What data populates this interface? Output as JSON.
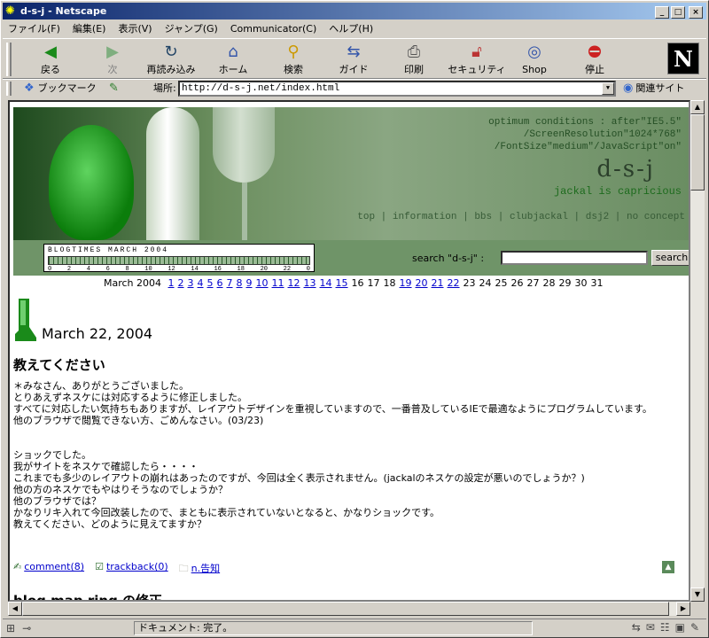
{
  "window": {
    "title": "d-s-j - Netscape",
    "min": "_",
    "max": "□",
    "close": "×"
  },
  "menu": [
    "ファイル(F)",
    "編集(E)",
    "表示(V)",
    "ジャンプ(G)",
    "Communicator(C)",
    "ヘルプ(H)"
  ],
  "toolbar": {
    "buttons": [
      {
        "label": "戻る",
        "icon": "back-icon"
      },
      {
        "label": "次",
        "icon": "forward-icon"
      },
      {
        "label": "再読み込み",
        "icon": "reload-icon"
      },
      {
        "label": "ホーム",
        "icon": "home-icon"
      },
      {
        "label": "検索",
        "icon": "search-icon"
      },
      {
        "label": "ガイド",
        "icon": "guide-icon"
      },
      {
        "label": "印刷",
        "icon": "print-icon"
      },
      {
        "label": "セキュリティ",
        "icon": "security-icon"
      },
      {
        "label": "Shop",
        "icon": "shop-icon"
      },
      {
        "label": "停止",
        "icon": "stop-icon"
      }
    ],
    "logo": "N"
  },
  "location": {
    "bookmark": "ブックマーク",
    "label": "場所:",
    "url": "http://d-s-j.net/index.html",
    "related": "関連サイト"
  },
  "banner": {
    "opt1": "optimum conditions : after\"IE5.5\"",
    "opt2": "/ScreenResolution\"1024*768\"",
    "opt3": "/FontSize\"medium\"/JavaScript\"on\"",
    "logo": "d-s-j",
    "subtitle": "jackal is capricious",
    "nav": [
      "top",
      "information",
      "bbs",
      "clubjackal",
      "dsj2",
      "no concept"
    ]
  },
  "blogtimes": {
    "title": "BLOGTIMES  MARCH 2004",
    "axis": [
      "0",
      "2",
      "4",
      "6",
      "8",
      "10",
      "12",
      "14",
      "16",
      "18",
      "20",
      "22",
      "0"
    ]
  },
  "search": {
    "label": "search \"d-s-j\" :",
    "button": "search",
    "value": ""
  },
  "calendar": {
    "month": "March 2004",
    "days": [
      {
        "d": "1",
        "link": true
      },
      {
        "d": "2",
        "link": true
      },
      {
        "d": "3",
        "link": true
      },
      {
        "d": "4",
        "link": true
      },
      {
        "d": "5",
        "link": true
      },
      {
        "d": "6",
        "link": true
      },
      {
        "d": "7",
        "link": true
      },
      {
        "d": "8",
        "link": true
      },
      {
        "d": "9",
        "link": true
      },
      {
        "d": "10",
        "link": true
      },
      {
        "d": "11",
        "link": true
      },
      {
        "d": "12",
        "link": true
      },
      {
        "d": "13",
        "link": true
      },
      {
        "d": "14",
        "link": true
      },
      {
        "d": "15",
        "link": true
      },
      {
        "d": "16",
        "link": false
      },
      {
        "d": "17",
        "link": false
      },
      {
        "d": "18",
        "link": false
      },
      {
        "d": "19",
        "link": true
      },
      {
        "d": "20",
        "link": true
      },
      {
        "d": "21",
        "link": true
      },
      {
        "d": "22",
        "link": true
      },
      {
        "d": "23",
        "link": false
      },
      {
        "d": "24",
        "link": false
      },
      {
        "d": "25",
        "link": false
      },
      {
        "d": "26",
        "link": false
      },
      {
        "d": "27",
        "link": false
      },
      {
        "d": "28",
        "link": false
      },
      {
        "d": "29",
        "link": false
      },
      {
        "d": "30",
        "link": false
      },
      {
        "d": "31",
        "link": false
      }
    ]
  },
  "post": {
    "date": "March 22, 2004",
    "title": "教えてください",
    "para1": "＊みなさん、ありがとうございました。\nとりあえずネスケには対応するように修正しました。\nすべてに対応したい気持ちもありますが、レイアウトデザインを重視していますので、一番普及しているIEで最適なようにプログラムしています。\n他のブラウザで閲覧できない方、ごめんなさい。(03/23)",
    "para2": "ショックでした。\n我がサイトをネスケで確認したら・・・・\nこれまでも多少のレイアウトの崩れはあったのですが、今回は全く表示されません。(jackalのネスケの設定が悪いのでしょうか？)\n他の方のネスケでもやはりそうなのでしょうか？\n他のブラウザでは？\nかなりリキ入れて今回改装したので、まともに表示されていないとなると、かなりショックです。\n教えてください、どのように見えてますか？",
    "comment": "comment(8)",
    "trackback": "trackback(0)",
    "category": "n.告知"
  },
  "next_post_title": "blog map ring の修正",
  "status": {
    "text": "ドキュメント: 完了。"
  },
  "colors": {
    "banner_green": "#6f9468",
    "link": "#0000cc",
    "title_bar": "#0a246a"
  }
}
